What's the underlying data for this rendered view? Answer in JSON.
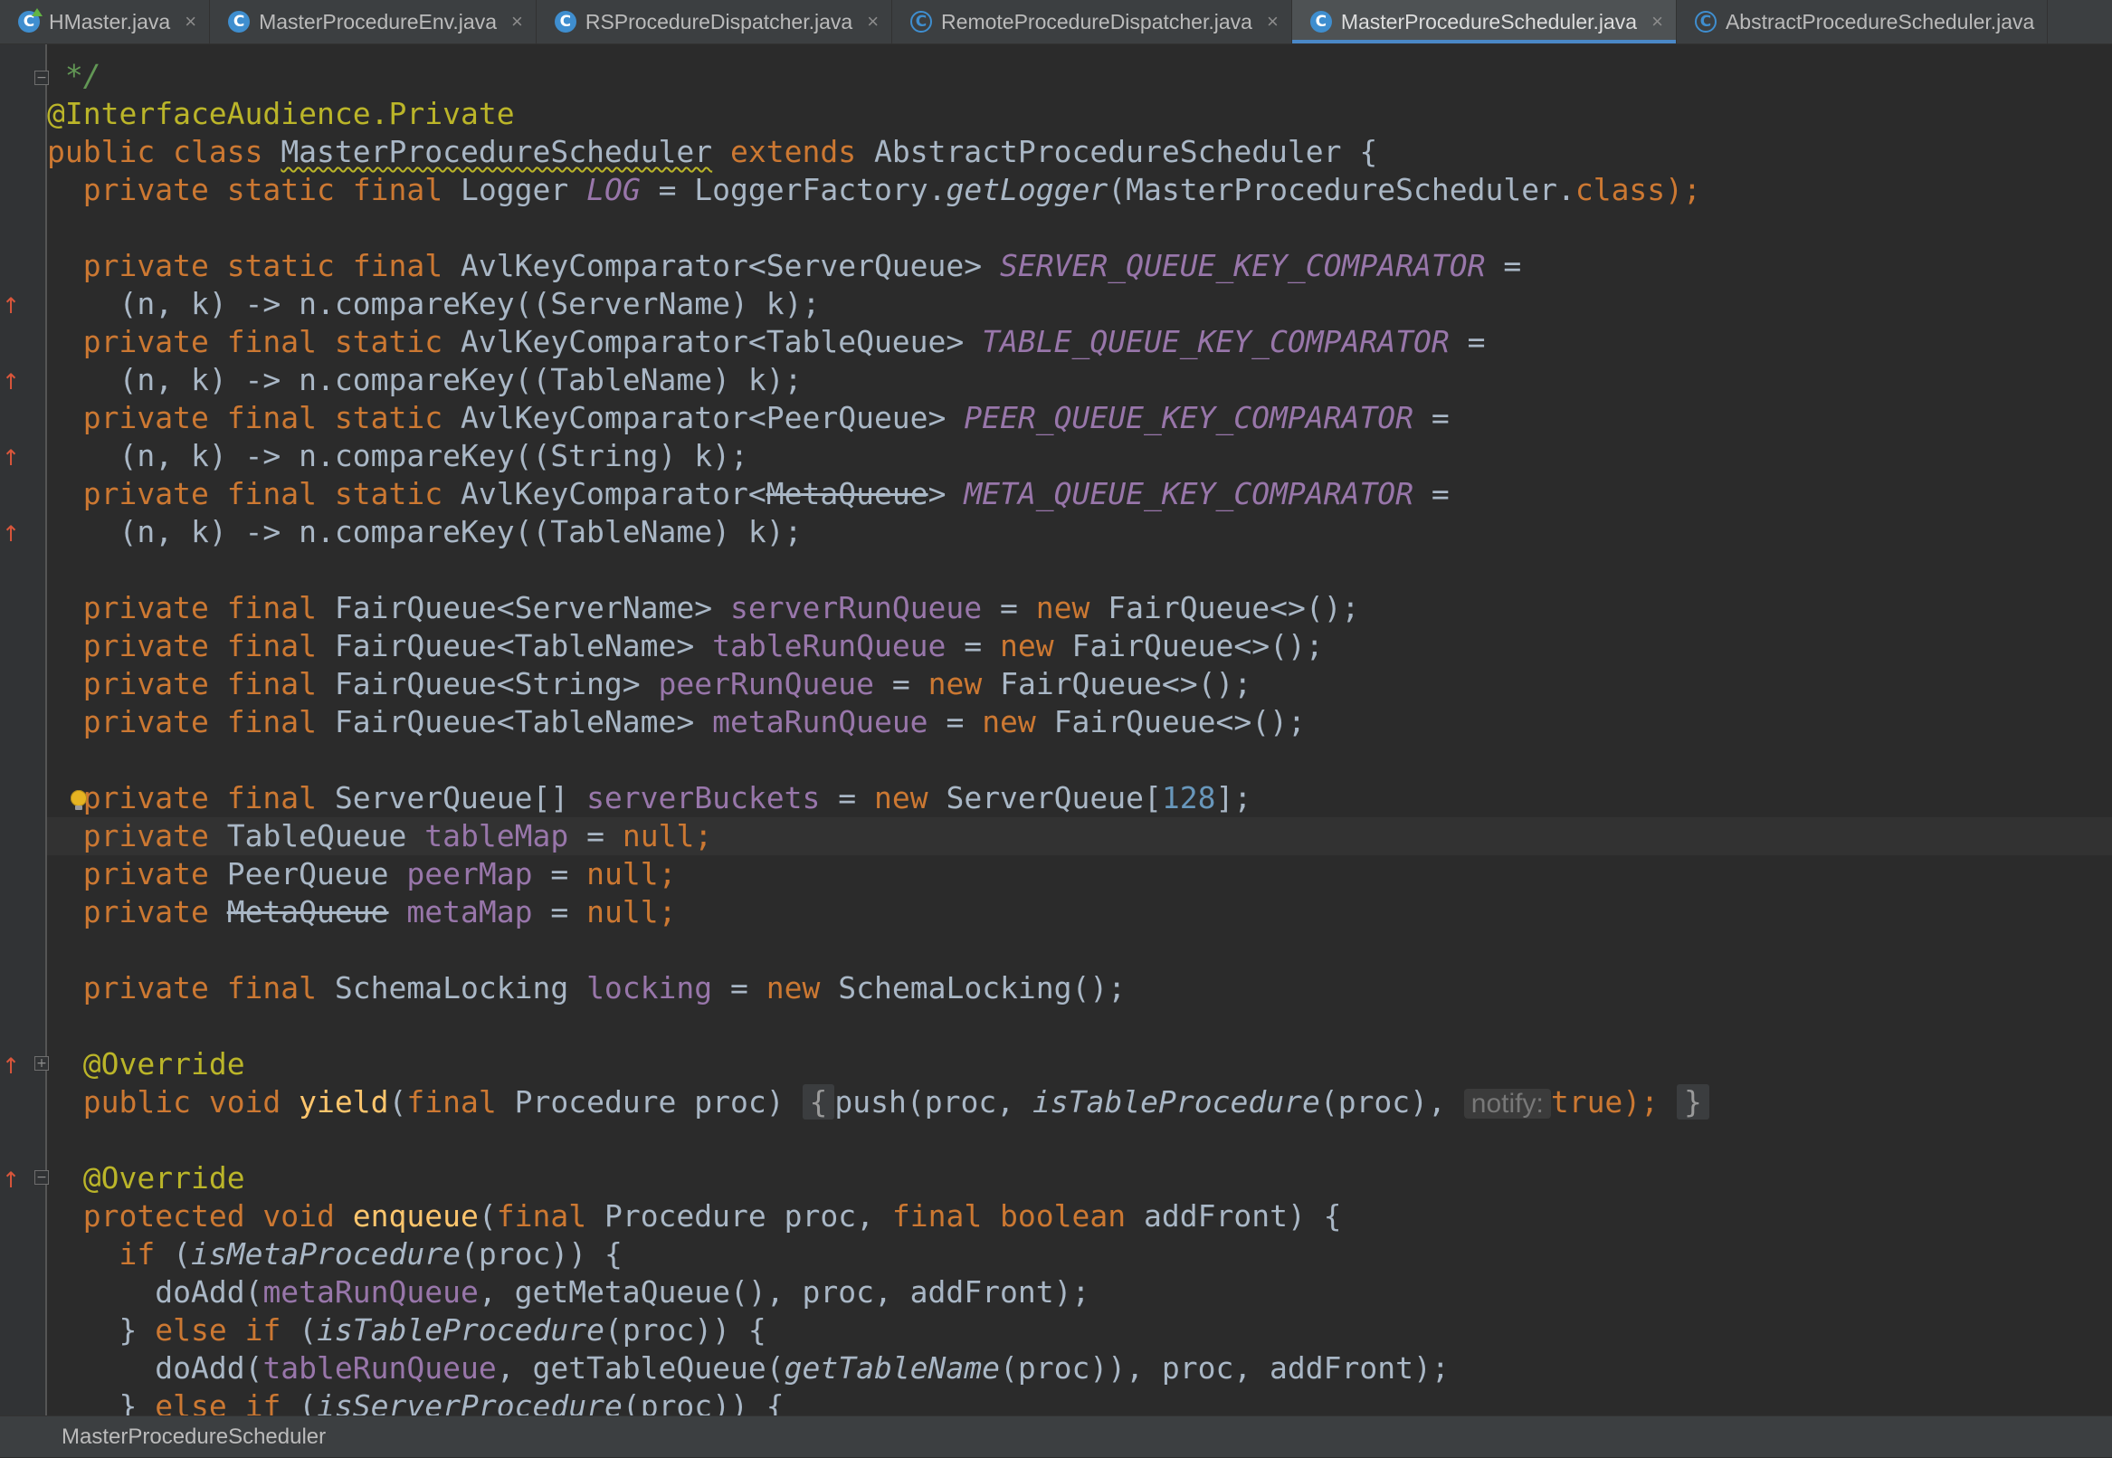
{
  "tabs": [
    {
      "label": "HMaster.java",
      "icon": "class-icon-main",
      "active": false
    },
    {
      "label": "MasterProcedureEnv.java",
      "icon": "class-icon",
      "active": false
    },
    {
      "label": "RSProcedureDispatcher.java",
      "icon": "class-icon",
      "active": false
    },
    {
      "label": "RemoteProcedureDispatcher.java",
      "icon": "abstract-class-icon",
      "active": false
    },
    {
      "label": "MasterProcedureScheduler.java",
      "icon": "class-icon",
      "active": true
    },
    {
      "label": "AbstractProcedureScheduler.java",
      "icon": "abstract-class-icon",
      "active": false
    }
  ],
  "tab_close_glyph": "×",
  "icon_letter": "C",
  "code": {
    "l0_comment": " */",
    "l1_annotation": "@InterfaceAudience.",
    "l1_annotation_b": "Private",
    "l2_public": "public",
    "l2_class": "class",
    "l2_name": "MasterProcedureScheduler",
    "l2_extends": "extends",
    "l2_super": "AbstractProcedureScheduler {",
    "l3_mods": "private static final",
    "l3_type": "Logger",
    "l3_field": "LOG",
    "l3_eq": "= LoggerFactory.",
    "l3_method": "getLogger",
    "l3_arg": "(MasterProcedureScheduler.",
    "l3_class": "class",
    "l3_end": ");",
    "l5_mods": "private static final",
    "l5_type": "AvlKeyComparator<ServerQueue>",
    "l5_field": "SERVER_QUEUE_KEY_COMPARATOR",
    "l5_eq": "=",
    "l6_body": "(n, k) -> n.compareKey((ServerName) k);",
    "l7_mods": "private final static",
    "l7_type": "AvlKeyComparator<TableQueue>",
    "l7_field": "TABLE_QUEUE_KEY_COMPARATOR",
    "l7_eq": "=",
    "l8_body": "(n, k) -> n.compareKey((TableName) k);",
    "l9_mods": "private final static",
    "l9_type": "AvlKeyComparator<PeerQueue>",
    "l9_field": "PEER_QUEUE_KEY_COMPARATOR",
    "l9_eq": "=",
    "l10_body": "(n, k) -> n.compareKey((String) k);",
    "l11_mods": "private final static",
    "l11_type_a": "AvlKeyComparator<",
    "l11_type_b": "MetaQueue",
    "l11_type_c": ">",
    "l11_field": "META_QUEUE_KEY_COMPARATOR",
    "l11_eq": "=",
    "l12_body": "(n, k) -> n.compareKey((TableName) k);",
    "l14_mods": "private final",
    "l14_type": "FairQueue<ServerName>",
    "l14_field": "serverRunQueue",
    "l14_eq": "=",
    "l14_new": "new",
    "l14_rhs": "FairQueue<>();",
    "l15_mods": "private final",
    "l15_type": "FairQueue<TableName>",
    "l15_field": "tableRunQueue",
    "l15_eq": "=",
    "l15_new": "new",
    "l15_rhs": "FairQueue<>();",
    "l16_mods": "private final",
    "l16_type": "FairQueue<String>",
    "l16_field": "peerRunQueue",
    "l16_eq": "=",
    "l16_new": "new",
    "l16_rhs": "FairQueue<>();",
    "l17_mods": "private final",
    "l17_type": "FairQueue<TableName>",
    "l17_field": "metaRunQueue",
    "l17_eq": "=",
    "l17_new": "new",
    "l17_rhs": "FairQueue<>();",
    "l19_mods": "private final",
    "l19_type": "ServerQueue[]",
    "l19_field": "serverBuckets",
    "l19_eq": "=",
    "l19_new": "new",
    "l19_rhs_a": "ServerQueue[",
    "l19_num": "128",
    "l19_rhs_b": "];",
    "l20_mods": "private",
    "l20_type": "TableQueue",
    "l20_field": "tableMap",
    "l20_eq": "=",
    "l20_null": "null",
    "l20_end": ";",
    "l21_mods": "private",
    "l21_type": "PeerQueue",
    "l21_field": "peerMap",
    "l21_eq": "=",
    "l21_null": "null",
    "l21_end": ";",
    "l22_mods": "private",
    "l22_type": "MetaQueue",
    "l22_field": "metaMap",
    "l22_eq": "=",
    "l22_null": "null",
    "l22_end": ";",
    "l24_mods": "private final",
    "l24_type": "SchemaLocking",
    "l24_field": "locking",
    "l24_eq": "=",
    "l24_new": "new",
    "l24_rhs": "SchemaLocking();",
    "l26_ann": "@Override",
    "l27_mods": "public void",
    "l27_method": "yield",
    "l27_open": "(",
    "l27_final": "final",
    "l27_params": "Procedure proc)",
    "l27_brace_open": "{",
    "l27_call": "push(proc,",
    "l27_static_call": "isTableProcedure",
    "l27_arg": "(proc),",
    "l27_hint": "notify:",
    "l27_true": "true",
    "l27_semi": ");",
    "l27_brace_close": "}",
    "l29_ann": "@Override",
    "l30_mods": "protected void",
    "l30_method": "enqueue",
    "l30_open": "(",
    "l30_final1": "final",
    "l30_p1": "Procedure proc,",
    "l30_final2": "final boolean",
    "l30_p2": "addFront) {",
    "l31_if": "if",
    "l31_open": "(",
    "l31_call": "isMetaProcedure",
    "l31_rest": "(proc)) {",
    "l32_call": "doAdd(",
    "l32_field": "metaRunQueue",
    "l32_rest": ", getMetaQueue(), proc, addFront);",
    "l33_close": "}",
    "l33_else_if": "else if",
    "l33_open": "(",
    "l33_call": "isTableProcedure",
    "l33_rest": "(proc)) {",
    "l34_call": "doAdd(",
    "l34_field": "tableRunQueue",
    "l34_mid": ", getTableQueue(",
    "l34_static": "getTableName",
    "l34_rest": "(proc)), proc, addFront);",
    "l35_close": "}",
    "l35_else_if": "else if",
    "l35_open": "(",
    "l35_call": "isServerProcedure",
    "l35_rest": "(proc)) {"
  },
  "gutter": {
    "arrow_glyph": "↑",
    "fold_collapsed_glyph": "+",
    "fold_expanded_glyph": "−"
  },
  "statusbar": {
    "breadcrumb": "MasterProcedureScheduler"
  }
}
